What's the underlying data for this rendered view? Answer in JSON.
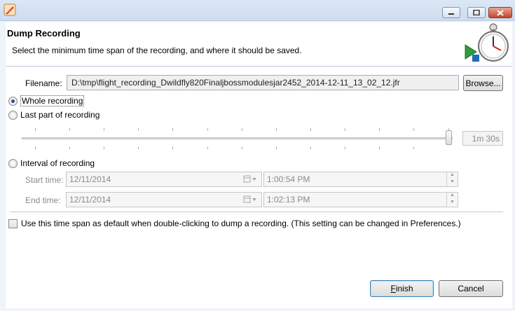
{
  "window": {
    "icon": "app-flame-icon"
  },
  "header": {
    "title": "Dump Recording",
    "description": "Select the minimum time span of the recording, and where it should be saved.",
    "icon": "stopwatch-record-icon"
  },
  "filename": {
    "label": "Filename:",
    "value": "D:\\tmp\\flight_recording_Dwildfly820Finaljbossmodulesjar2452_2014-12-11_13_02_12.jfr",
    "browse_label": "Browse..."
  },
  "options": {
    "whole_recording": "Whole recording",
    "last_part": "Last part of recording",
    "interval": "Interval of recording",
    "selected": "whole_recording"
  },
  "slider": {
    "value_text": "1m 30s",
    "position_fraction": 1.0
  },
  "interval": {
    "start_label": "Start time:",
    "start_date": "12/11/2014",
    "start_time": "1:00:54 PM",
    "end_label": "End time:",
    "end_date": "12/11/2014",
    "end_time": "1:02:13 PM"
  },
  "default_checkbox": {
    "label": "Use this time span as default when double-clicking to dump a recording. (This setting can be changed in Preferences.)",
    "checked": false
  },
  "buttons": {
    "finish": "Finish",
    "cancel": "Cancel"
  }
}
